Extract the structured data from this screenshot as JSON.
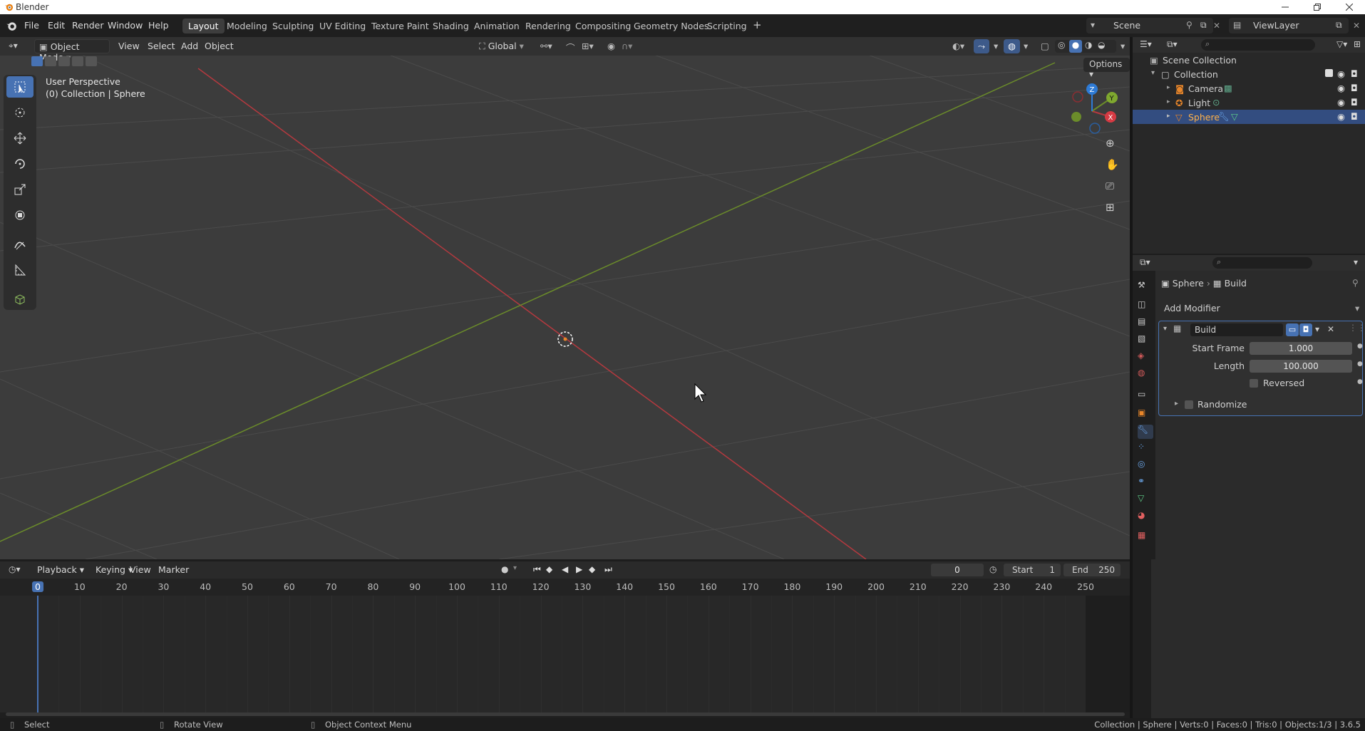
{
  "window": {
    "title": "Blender"
  },
  "menus": [
    "File",
    "Edit",
    "Render",
    "Window",
    "Help"
  ],
  "workspaces": [
    {
      "label": "Layout",
      "active": true
    },
    {
      "label": "Modeling"
    },
    {
      "label": "Sculpting"
    },
    {
      "label": "UV Editing"
    },
    {
      "label": "Texture Paint"
    },
    {
      "label": "Shading"
    },
    {
      "label": "Animation"
    },
    {
      "label": "Rendering"
    },
    {
      "label": "Compositing"
    },
    {
      "label": "Geometry Nodes"
    },
    {
      "label": "Scripting"
    }
  ],
  "scene": {
    "name": "Scene",
    "view_layer": "ViewLayer"
  },
  "viewport": {
    "mode": "Object Mode",
    "menus": [
      "View",
      "Select",
      "Add",
      "Object"
    ],
    "orientation": "Global",
    "options_label": "Options",
    "overlay_line1": "User Perspective",
    "overlay_line2": "(0) Collection | Sphere",
    "gizmo_axes": [
      "X",
      "Y",
      "Z"
    ]
  },
  "outliner": {
    "root": "Scene Collection",
    "collection": "Collection",
    "items": [
      {
        "name": "Camera"
      },
      {
        "name": "Light"
      },
      {
        "name": "Sphere",
        "selected": true
      }
    ]
  },
  "properties": {
    "breadcrumb_object": "Sphere",
    "breadcrumb_modifier": "Build",
    "add_modifier": "Add Modifier",
    "modifier_name": "Build",
    "start_frame_label": "Start Frame",
    "start_frame_value": "1.000",
    "length_label": "Length",
    "length_value": "100.000",
    "reversed_label": "Reversed",
    "randomize_label": "Randomize"
  },
  "timeline": {
    "menus": [
      "Playback",
      "Keying",
      "View",
      "Marker"
    ],
    "current_frame": "0",
    "start_label": "Start",
    "start_value": "1",
    "end_label": "End",
    "end_value": "250",
    "ticks": [
      "0",
      "10",
      "20",
      "30",
      "40",
      "50",
      "60",
      "70",
      "80",
      "90",
      "100",
      "110",
      "120",
      "130",
      "140",
      "150",
      "160",
      "170",
      "180",
      "190",
      "200",
      "210",
      "220",
      "230",
      "240",
      "250"
    ]
  },
  "statusbar": {
    "select": "Select",
    "rotate": "Rotate View",
    "context": "Object Context Menu",
    "stats": "Collection | Sphere | Verts:0 | Faces:0 | Tris:0 | Objects:1/3 | 3.6.5"
  },
  "colors": {
    "accent": "#4772b3",
    "x_axis": "#b5393f",
    "y_axis": "#6b8c2a",
    "z_axis": "#2e7bd6",
    "orange": "#e8862a"
  }
}
